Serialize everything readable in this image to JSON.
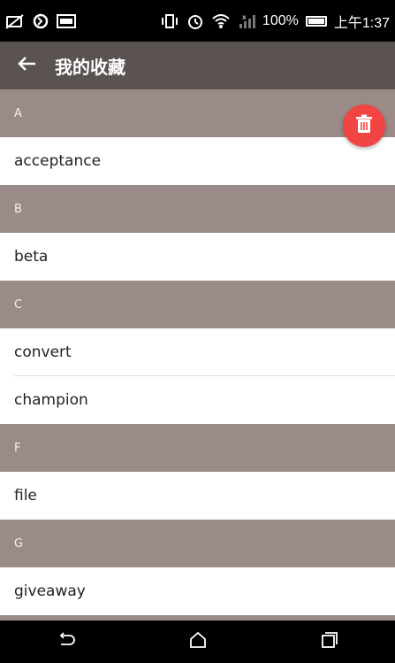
{
  "status_bar": {
    "battery_percent": "100%",
    "time": "上午1:37"
  },
  "app_bar": {
    "title": "我的收藏"
  },
  "sections": [
    {
      "header": "A",
      "items": [
        "acceptance"
      ]
    },
    {
      "header": "B",
      "items": [
        "beta"
      ]
    },
    {
      "header": "C",
      "items": [
        "convert",
        "champion"
      ]
    },
    {
      "header": "F",
      "items": [
        "file"
      ]
    },
    {
      "header": "G",
      "items": [
        "giveaway"
      ]
    }
  ],
  "colors": {
    "app_bar": "#5a5352",
    "section_header": "#9b8b88",
    "fab": "#f04542"
  }
}
